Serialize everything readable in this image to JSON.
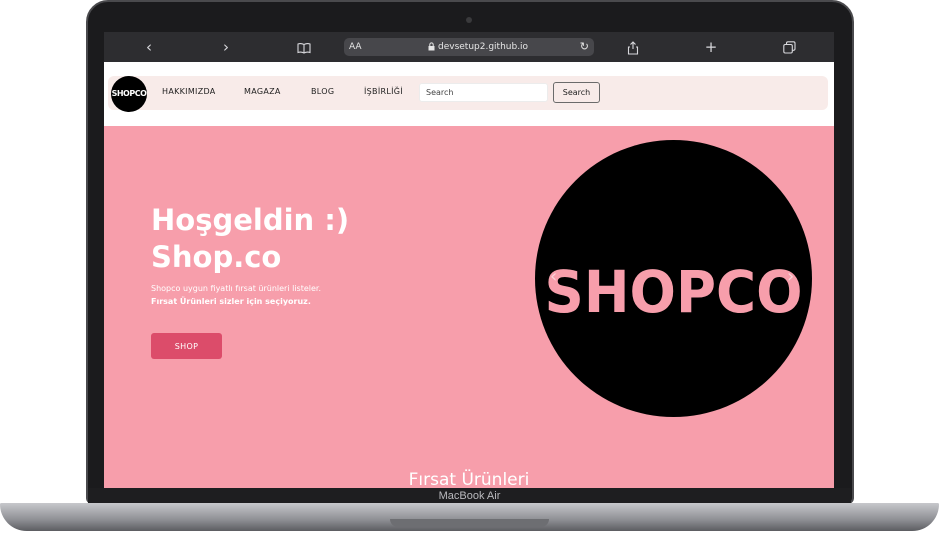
{
  "device": {
    "label": "MacBook Air"
  },
  "browser": {
    "text_size_label": "AA",
    "url": "devsetup2.github.io",
    "icons": [
      "back-icon",
      "forward-icon",
      "reader-icon",
      "lock-icon",
      "reload-icon",
      "share-icon",
      "new-tab-icon",
      "tabs-icon"
    ]
  },
  "site": {
    "logo_text": "SHOPCO",
    "nav": {
      "items": [
        {
          "label": "HAKKIMIZDA"
        },
        {
          "label": "MAGAZA"
        },
        {
          "label": "BLOG"
        },
        {
          "label": "İŞBİRLİĞİ"
        }
      ],
      "search_placeholder": "Search",
      "search_button": "Search"
    },
    "hero": {
      "title_line1": "Hoşgeldin :)",
      "title_line2": "Shop.co",
      "desc_line1": "Shopco uygun fiyatlı fırsat ürünleri listeler.",
      "desc_line2": "Fırsat Ürünleri sizler için seçiyoruz.",
      "button": "SHOP",
      "big_logo_text": "SHOPCO",
      "prev_arrow": "‹",
      "next_arrow": "›"
    },
    "section_title": "Fırsat Ürünleri"
  },
  "colors": {
    "hero_bg": "#f79eab",
    "button_bg": "#dc4c6a",
    "navbar_bg": "#f8ebe9",
    "logo_bg": "#000000"
  }
}
